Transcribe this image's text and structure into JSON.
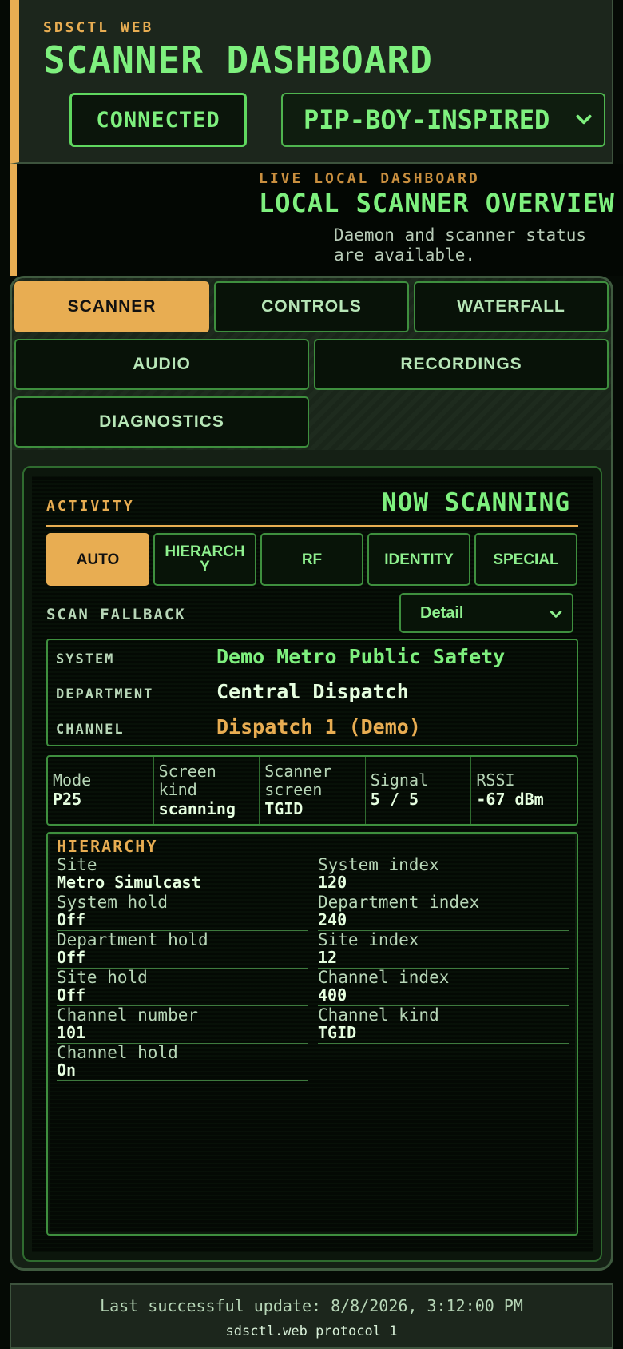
{
  "header": {
    "brand": "SDSCTL WEB",
    "title": "SCANNER DASHBOARD",
    "connection_status": "CONNECTED",
    "theme_selected": "PIP-BOY-INSPIRED"
  },
  "hero": {
    "kicker": "LIVE LOCAL DASHBOARD",
    "title": "LOCAL SCANNER OVERVIEW",
    "subtitle": "Daemon and scanner status are available."
  },
  "tabs": [
    {
      "label": "SCANNER",
      "active": true
    },
    {
      "label": "CONTROLS",
      "active": false
    },
    {
      "label": "WATERFALL",
      "active": false
    },
    {
      "label": "AUDIO",
      "active": false
    },
    {
      "label": "RECORDINGS",
      "active": false
    },
    {
      "label": "DIAGNOSTICS",
      "active": false
    }
  ],
  "activity": {
    "label": "ACTIVITY",
    "status": "NOW SCANNING",
    "modes": [
      {
        "label": "AUTO",
        "active": true
      },
      {
        "label": "HIERARCH Y",
        "active": false
      },
      {
        "label": "RF",
        "active": false
      },
      {
        "label": "IDENTITY",
        "active": false
      },
      {
        "label": "SPECIAL",
        "active": false
      }
    ],
    "fallback_label": "SCAN FALLBACK",
    "fallback_value": "Detail"
  },
  "info": [
    {
      "key": "SYSTEM",
      "value": "Demo Metro Public Safety",
      "color": "#7ef07e"
    },
    {
      "key": "DEPARTMENT",
      "value": "Central Dispatch",
      "color": "#e6ffe0"
    },
    {
      "key": "CHANNEL",
      "value": "Dispatch 1 (Demo)",
      "color": "#e8ad52"
    }
  ],
  "metrics": [
    {
      "key": "Mode",
      "value": "P25"
    },
    {
      "key": "Screen kind",
      "value": "scanning"
    },
    {
      "key": "Scanner screen",
      "value": "TGID"
    },
    {
      "key": "Signal",
      "value": "5 / 5"
    },
    {
      "key": "RSSI",
      "value": "-67 dBm"
    }
  ],
  "hierarchy": {
    "title": "HIERARCHY",
    "left": [
      {
        "key": "Site",
        "value": "Metro Simulcast"
      },
      {
        "key": "System hold",
        "value": "Off"
      },
      {
        "key": "Department hold",
        "value": "Off"
      },
      {
        "key": "Site hold",
        "value": "Off"
      },
      {
        "key": "Channel number",
        "value": "101"
      },
      {
        "key": "Channel hold",
        "value": "On"
      }
    ],
    "right": [
      {
        "key": "System index",
        "value": "120"
      },
      {
        "key": "Department index",
        "value": "240"
      },
      {
        "key": "Site index",
        "value": "12"
      },
      {
        "key": "Channel index",
        "value": "400"
      },
      {
        "key": "Channel kind",
        "value": "TGID"
      }
    ]
  },
  "footer": {
    "last_update": "Last successful update: 8/8/2026, 3:12:00 PM",
    "protocol": "sdsctl.web protocol 1"
  },
  "colors": {
    "accent": "#e8ad52",
    "primary": "#7ef07e",
    "background": "#050a05"
  },
  "icons": {
    "theme_dropdown": "chevron-down-icon",
    "fallback_dropdown": "chevron-down-icon"
  }
}
